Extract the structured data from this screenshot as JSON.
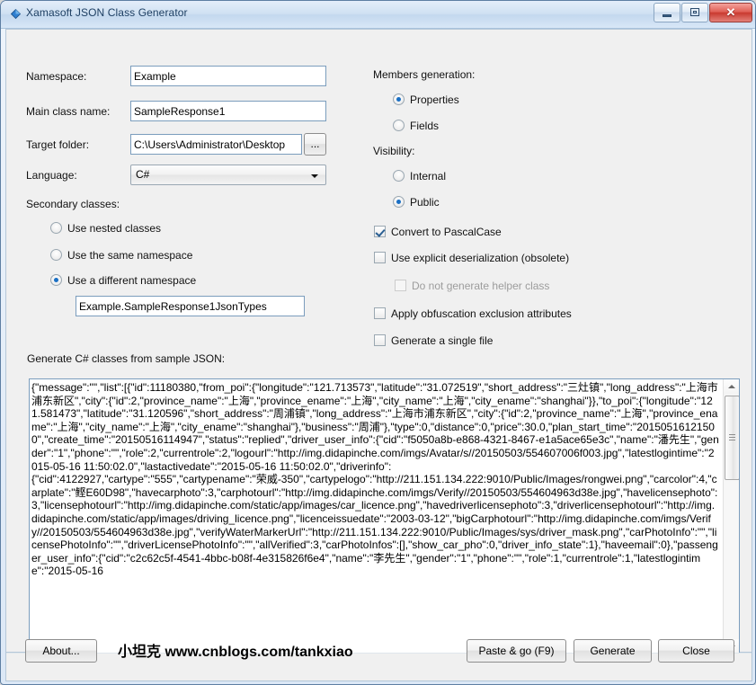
{
  "window": {
    "title": "Xamasoft JSON Class Generator",
    "icon": "diamond-icon",
    "minimize_label": "Minimize",
    "maximize_label": "Maximize",
    "close_label": "✕"
  },
  "left_panel": {
    "namespace_label": "Namespace:",
    "namespace_value": "Example",
    "main_class_label": "Main class name:",
    "main_class_value": "SampleResponse1",
    "target_folder_label": "Target folder:",
    "target_folder_value": "C:\\Users\\Administrator\\Desktop",
    "browse_label": "...",
    "language_label": "Language:",
    "language_value": "C#",
    "secondary_classes_label": "Secondary classes:",
    "secondary_options": [
      {
        "label": "Use nested classes",
        "selected": false
      },
      {
        "label": "Use the same namespace",
        "selected": false
      },
      {
        "label": "Use a different namespace",
        "selected": true
      }
    ],
    "secondary_namespace_value": "Example.SampleResponse1JsonTypes"
  },
  "right_panel": {
    "members_generation_label": "Members generation:",
    "members_options": [
      {
        "label": "Properties",
        "selected": true
      },
      {
        "label": "Fields",
        "selected": false
      }
    ],
    "visibility_label": "Visibility:",
    "visibility_options": [
      {
        "label": "Internal",
        "selected": false
      },
      {
        "label": "Public",
        "selected": true
      }
    ],
    "checkboxes": [
      {
        "label": "Convert to PascalCase",
        "checked": true,
        "disabled": false
      },
      {
        "label": "Use explicit deserialization (obsolete)",
        "checked": false,
        "disabled": false
      },
      {
        "label": "Do not generate helper class",
        "checked": false,
        "disabled": true
      },
      {
        "label": "Apply obfuscation exclusion attributes",
        "checked": false,
        "disabled": false
      },
      {
        "label": "Generate a single file",
        "checked": false,
        "disabled": false
      }
    ]
  },
  "json_area": {
    "label": "Generate C# classes from sample JSON:",
    "value": "{\"message\":\"\",\"list\":[{\"id\":11180380,\"from_poi\":{\"longitude\":\"121.713573\",\"latitude\":\"31.072519\",\"short_address\":\"三灶镇\",\"long_address\":\"上海市浦东新区\",\"city\":{\"id\":2,\"province_name\":\"上海\",\"province_ename\":\"上海\",\"city_name\":\"上海\",\"city_ename\":\"shanghai\"}},\"to_poi\":{\"longitude\":\"121.581473\",\"latitude\":\"31.120596\",\"short_address\":\"周浦镇\",\"long_address\":\"上海市浦东新区\",\"city\":{\"id\":2,\"province_name\":\"上海\",\"province_ename\":\"上海\",\"city_name\":\"上海\",\"city_ename\":\"shanghai\"},\"business\":\"周浦\"},\"type\":0,\"distance\":0,\"price\":30.0,\"plan_start_time\":\"20150516121500\",\"create_time\":\"20150516114947\",\"status\":\"replied\",\"driver_user_info\":{\"cid\":\"f5050a8b-e868-4321-8467-e1a5ace65e3c\",\"name\":\"潘先生\",\"gender\":\"1\",\"phone\":\"\",\"role\":2,\"currentrole\":2,\"logourl\":\"http://img.didapinche.com/imgs/Avatar/s//20150503/554607006f003.jpg\",\"latestlogintime\":\"2015-05-16 11:50:02.0\",\"lastactivedate\":\"2015-05-16 11:50:02.0\",\"driverinfo\":\n{\"cid\":4122927,\"cartype\":\"555\",\"cartypename\":\"荣威-350\",\"cartypelogo\":\"http://211.151.134.222:9010/Public/Images/rongwei.png\",\"carcolor\":4,\"carplate\":\"鲣E60D98\",\"havecarphoto\":3,\"carphotourl\":\"http://img.didapinche.com/imgs/Verify//20150503/554604963d38e.jpg\",\"havelicensephoto\":3,\"licensephotourl\":\"http://img.didapinche.com/static/app/images/car_licence.png\",\"havedriverlicensephoto\":3,\"driverlicensephotourl\":\"http://img.didapinche.com/static/app/images/driving_licence.png\",\"licenceissuedate\":\"2003-03-12\",\"bigCarphotourl\":\"http://img.didapinche.com/imgs/Verify//20150503/554604963d38e.jpg\",\"verifyWaterMarkerUrl\":\"http://211.151.134.222:9010/Public/Images/sys/driver_mask.png\",\"carPhotoInfo\":\"\",\"licensePhotoInfo\":\"\",\"driverLicensePhotoInfo\":\"\",\"allVerified\":3,\"carPhotoInfos\":[],\"show_car_pho\":0,\"driver_info_state\":1},\"haveemail\":0},\"passenger_user_info\":{\"cid\":\"c2c62c5f-4541-4bbc-b08f-4e315826f6e4\",\"name\":\"李先生\",\"gender\":\"1\",\"phone\":\"\",\"role\":1,\"currentrole\":1,\"latestlogintime\":\"2015-05-16"
  },
  "footer": {
    "about_label": "About...",
    "promo_text": "小坦克 www.cnblogs.com/tankxiao",
    "paste_label": "Paste & go (F9)",
    "generate_label": "Generate",
    "close_label": "Close"
  },
  "colors": {
    "accent": "#1a6fc4",
    "title_text": "#1d3f63",
    "close_button": "#c93a30",
    "client_bg": "#f0f0f0"
  }
}
